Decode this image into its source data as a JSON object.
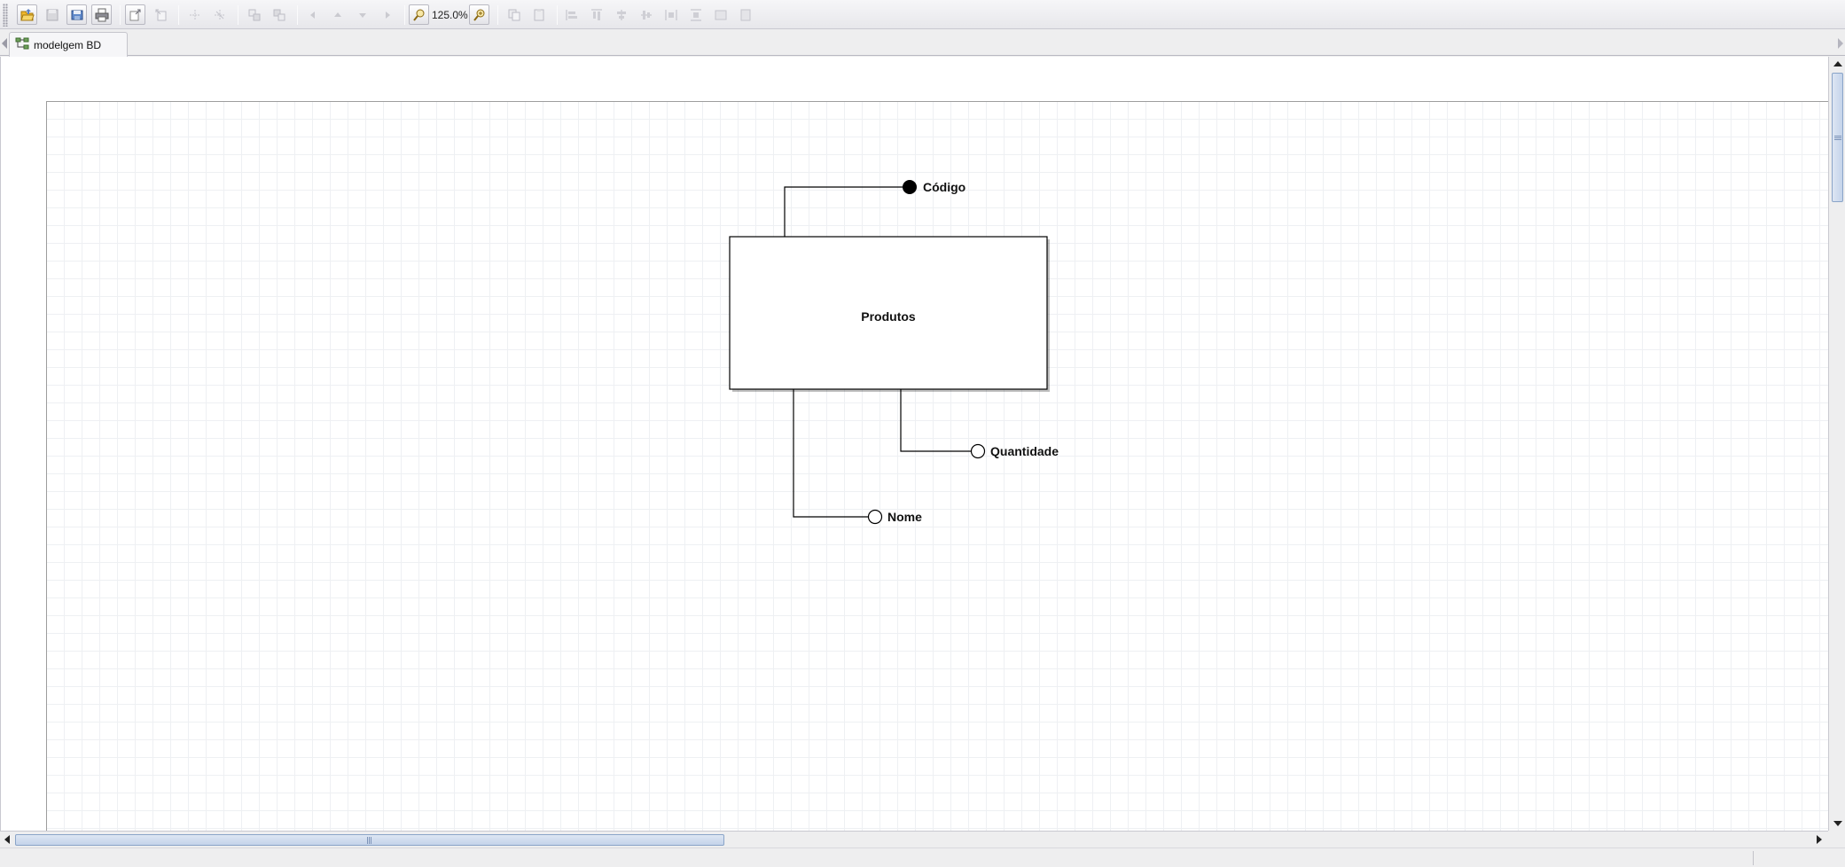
{
  "toolbar": {
    "zoom_level": "125.0%",
    "buttons": [
      {
        "icon": "open-folder-icon"
      },
      {
        "icon": "save-icon"
      },
      {
        "icon": "save-as-icon"
      },
      {
        "icon": "print-icon"
      },
      {
        "icon": "undo-icon"
      },
      {
        "icon": "redo-icon"
      },
      {
        "icon": "zoom-out-icon"
      },
      {
        "icon": "zoom-in-icon"
      }
    ]
  },
  "tabs": [
    {
      "label": "modelgem BD",
      "icon": "diagram-icon"
    }
  ],
  "diagram": {
    "entity": {
      "name": "Produtos"
    },
    "attributes": [
      {
        "name": "Código",
        "type": "primary-key",
        "marker": "filled"
      },
      {
        "name": "Quantidade",
        "type": "attribute",
        "marker": "hollow"
      },
      {
        "name": "Nome",
        "type": "attribute",
        "marker": "hollow"
      }
    ]
  },
  "colors": {
    "accent": "#f5c232",
    "scroll_thumb": "#c4d3ea",
    "grid": "#eef0f3"
  }
}
